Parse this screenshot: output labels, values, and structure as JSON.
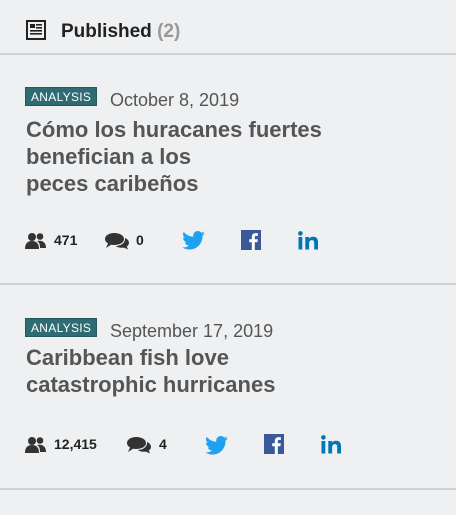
{
  "header": {
    "title": "Published",
    "count": "(2)",
    "icon": "newspaper-icon"
  },
  "articles": [
    {
      "badge": "ANALYSIS",
      "date": "October 8, 2019",
      "title": "Cómo los huracanes fuertes\nbenefician a los\npeces caribeños",
      "readers": "471",
      "comments": "0"
    },
    {
      "badge": "ANALYSIS",
      "date": "September 17, 2019",
      "title": "Caribbean fish love\ncatastrophic hurricanes",
      "readers": "12,415",
      "comments": "4"
    }
  ],
  "colors": {
    "badge": "#2f6b73",
    "twitter": "#1da1f2",
    "facebook": "#3b5998",
    "linkedin": "#0077b5",
    "divider": "#cfd3d6",
    "background": "#eef0f2"
  }
}
